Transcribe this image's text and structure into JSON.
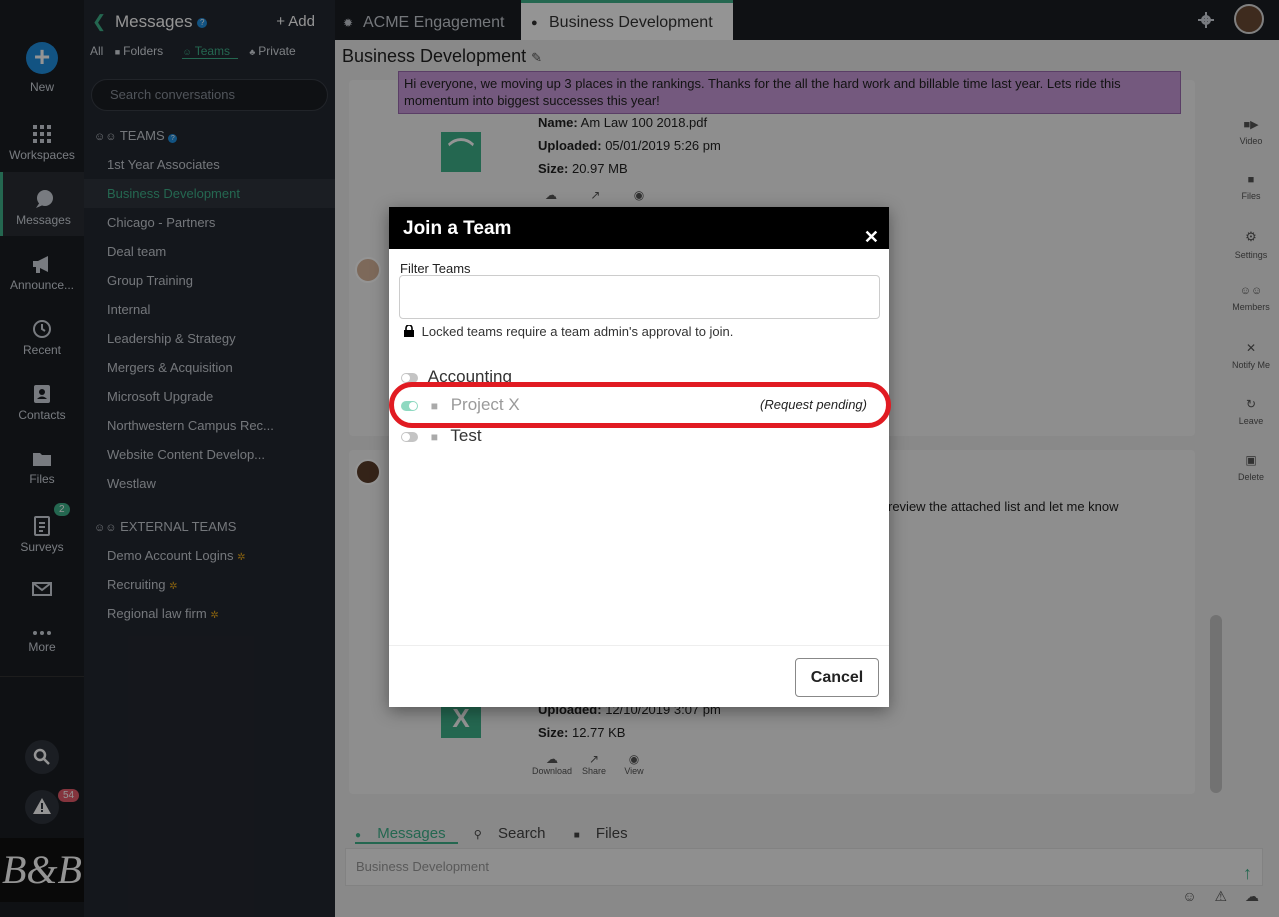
{
  "rail": {
    "new": "New",
    "workspaces": "Workspaces",
    "messages": "Messages",
    "announcements": "Announce...",
    "recent": "Recent",
    "contacts": "Contacts",
    "files": "Files",
    "surveys": "Surveys",
    "surveys_badge": "2",
    "more": "More",
    "alerts_badge": "54",
    "logo": "B&B"
  },
  "conv": {
    "title": "Messages",
    "add": "+ Add",
    "filters": [
      "All",
      "Folders",
      "Teams",
      "Private"
    ],
    "search_placeholder": "Search conversations",
    "teams_header": "TEAMS",
    "teams": [
      "1st Year Associates",
      "Business Development",
      "Chicago - Partners",
      "Deal team",
      "Group Training",
      "Internal",
      "Leadership & Strategy",
      "Mergers & Acquisition",
      "Microsoft Upgrade",
      "Northwestern Campus Rec...",
      "Website Content Develop...",
      "Westlaw"
    ],
    "external_header": "EXTERNAL TEAMS",
    "external": [
      "Demo Account Logins",
      "Recruiting",
      "Regional law firm"
    ]
  },
  "tabs": [
    "ACME Engagement",
    "Business Development"
  ],
  "main": {
    "title": "Business Development",
    "announcement": "Hi everyone, we moving up 3 places in the rankings.  Thanks for the all the hard work and billable time last year.  Lets ride this momentum into biggest successes this year!",
    "file1": {
      "name_label": "Name:",
      "name": "Am Law 100 2018.pdf",
      "uploaded_label": "Uploaded:",
      "uploaded": "05/01/2019 5:26 pm",
      "size_label": "Size:",
      "size": "20.97 MB"
    },
    "msg2_text": "review the attached list and let me know",
    "file2": {
      "uploaded_label": "Uploaded:",
      "uploaded": "12/10/2019 3:07 pm",
      "size_label": "Size:",
      "size": "12.77 KB",
      "actions": [
        "Download",
        "Share",
        "View"
      ]
    },
    "tools": [
      "Video",
      "Files",
      "Settings",
      "Members",
      "Notify Me",
      "Leave",
      "Delete"
    ],
    "bottom_tabs": [
      "Messages",
      "Search",
      "Files"
    ],
    "compose_placeholder": "Business Development"
  },
  "modal": {
    "title": "Join a Team",
    "filter_label": "Filter Teams",
    "filter_value": "",
    "lock_note": "Locked teams require a team admin's approval to join.",
    "teams": [
      {
        "name": "Accounting",
        "locked": false,
        "status": ""
      },
      {
        "name": "Project X",
        "locked": true,
        "status": "(Request pending)"
      },
      {
        "name": "Test",
        "locked": true,
        "status": ""
      }
    ],
    "cancel": "Cancel"
  },
  "colors": {
    "accent": "#3fb28b",
    "highlight": "#e11b22",
    "announcement": "#c99ad9"
  }
}
